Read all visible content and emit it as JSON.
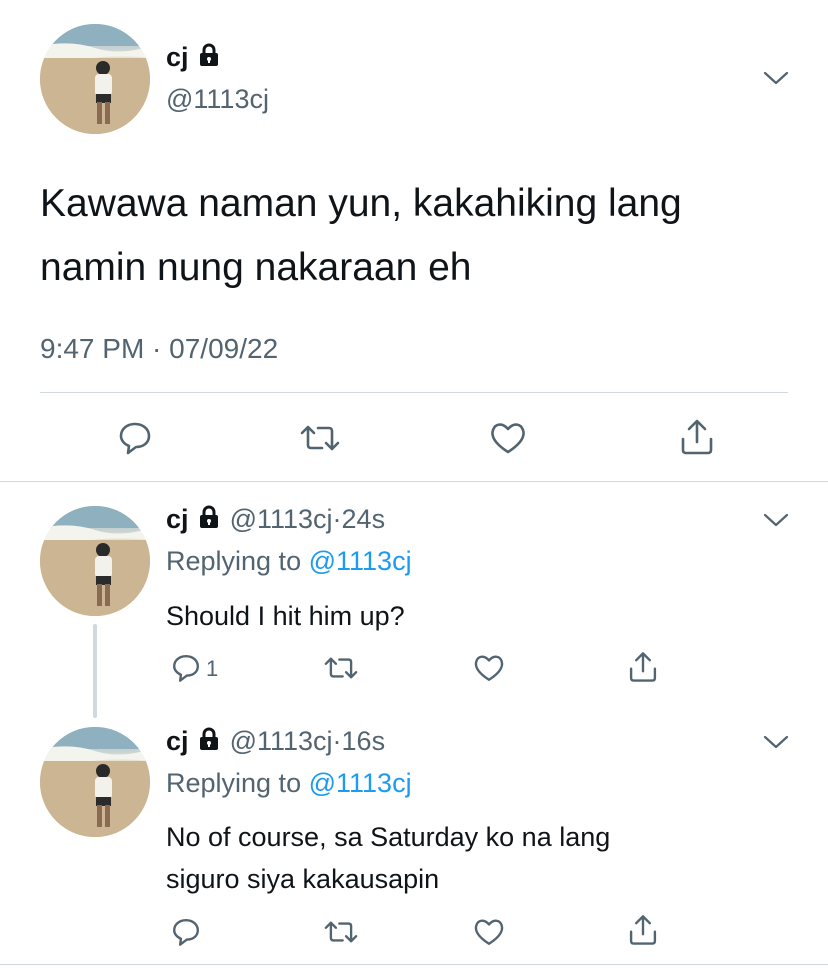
{
  "main_tweet": {
    "display_name": "cj",
    "handle": "@1113cj",
    "text_line1": "Kawawa naman yun, kakahiking lang",
    "text_line2": "namin nung nakaraan eh",
    "timestamp": "9:47 PM · 07/09/22"
  },
  "replies": [
    {
      "display_name": "cj",
      "handle": "@1113cj",
      "time": "24s",
      "replying_label": "Replying to",
      "replying_to": "@1113cj",
      "text_line1": "Should I hit him up?",
      "reply_count": "1"
    },
    {
      "display_name": "cj",
      "handle": "@1113cj",
      "time": "16s",
      "replying_label": "Replying to",
      "replying_to": "@1113cj",
      "text_line1": "No of course, sa Saturday ko na lang",
      "text_line2": "siguro siya kakausapin"
    }
  ],
  "colors": {
    "text": "#0f1419",
    "muted": "#536471",
    "link": "#1d9bf0",
    "divider": "#cfd9de",
    "thread_line": "#cfd9de"
  },
  "icons": [
    "lock-icon",
    "chevron-down-icon",
    "reply-icon",
    "retweet-icon",
    "like-icon",
    "share-icon"
  ]
}
